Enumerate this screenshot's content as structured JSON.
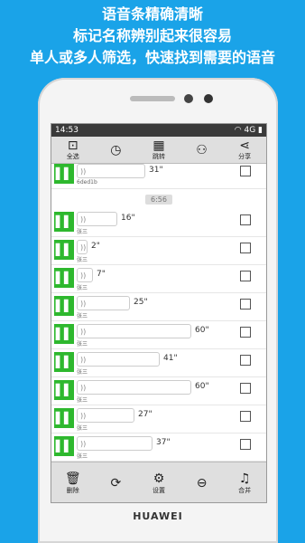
{
  "promo": {
    "line1": "语音条精确清晰",
    "line2": "标记名称辨别起来很容易",
    "line3": "单人或多人筛选，快速找到需要的语音"
  },
  "phone": {
    "brand": "HUAWEI"
  },
  "status": {
    "time": "14:53",
    "network": "4G"
  },
  "topbar": {
    "select_all": "全选",
    "jump": "跳转",
    "share": "分享"
  },
  "messages": {
    "first": {
      "duration": "31\"",
      "name": "6ded1b"
    },
    "timestamp": "6:56",
    "items": [
      {
        "duration": "16\"",
        "name": "张三"
      },
      {
        "duration": "2\"",
        "name": "张三"
      },
      {
        "duration": "7\"",
        "name": "张三"
      },
      {
        "duration": "25\"",
        "name": "张三"
      },
      {
        "duration": "60\"",
        "name": "张三"
      },
      {
        "duration": "41\"",
        "name": "张三"
      },
      {
        "duration": "60\"",
        "name": "张三"
      },
      {
        "duration": "27\"",
        "name": "张三"
      },
      {
        "duration": "37\"",
        "name": "张三"
      }
    ]
  },
  "bottombar": {
    "delete": "删除",
    "settings": "设置",
    "merge": "合并"
  }
}
